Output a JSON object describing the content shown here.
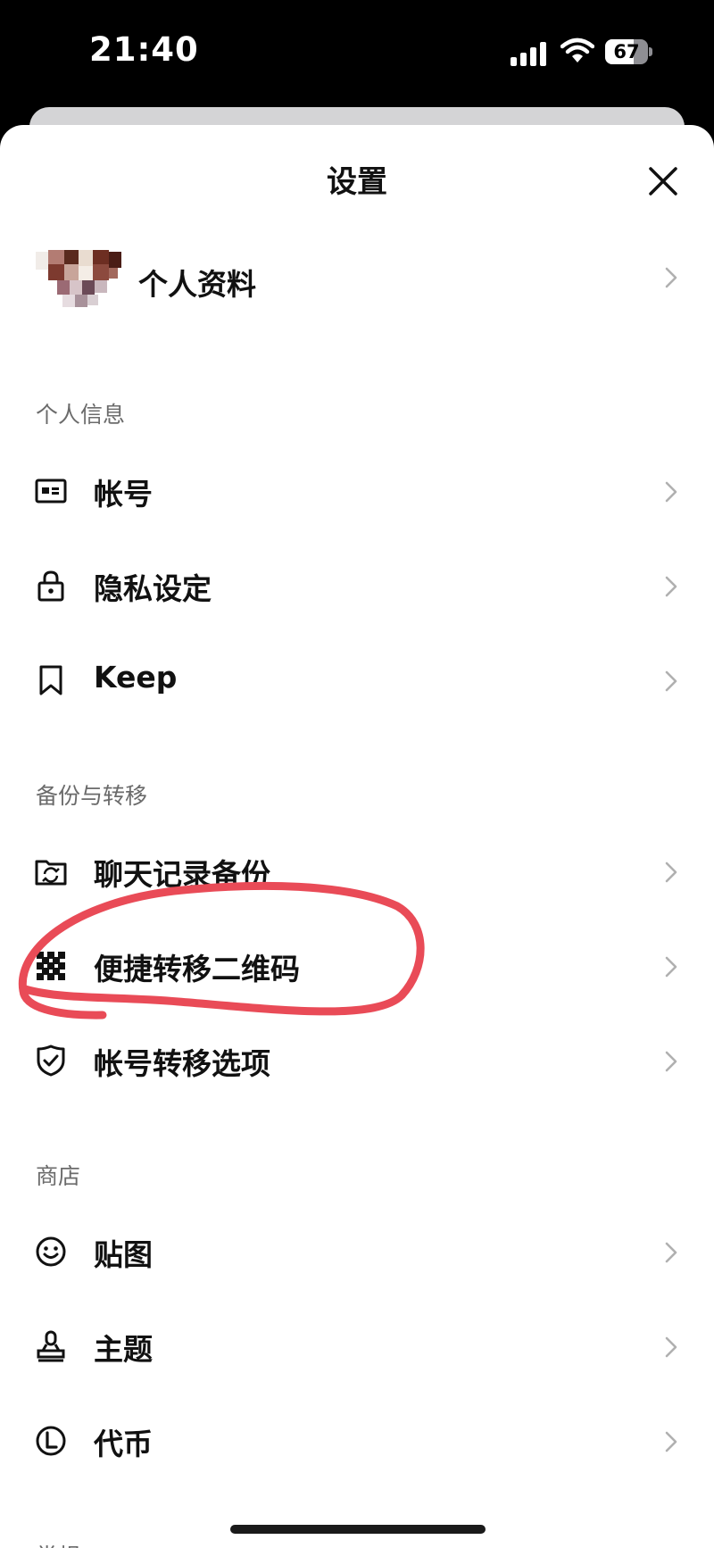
{
  "status_bar": {
    "time": "21:40",
    "battery_percent": "67",
    "battery_level": 0.67
  },
  "sheet": {
    "title": "设置"
  },
  "profile": {
    "label": "个人资料"
  },
  "sections": {
    "personal": {
      "header": "个人信息",
      "items": [
        {
          "label": "帐号",
          "icon": "id-card-icon"
        },
        {
          "label": "隐私设定",
          "icon": "lock-icon"
        },
        {
          "label": "Keep",
          "icon": "bookmark-icon"
        }
      ]
    },
    "backup": {
      "header": "备份与转移",
      "items": [
        {
          "label": "聊天记录备份",
          "icon": "folder-sync-icon"
        },
        {
          "label": "便捷转移二维码",
          "icon": "qr-code-icon"
        },
        {
          "label": "帐号转移选项",
          "icon": "shield-check-icon"
        }
      ]
    },
    "shop": {
      "header": "商店",
      "items": [
        {
          "label": "贴图",
          "icon": "smiley-icon"
        },
        {
          "label": "主题",
          "icon": "stamp-icon"
        },
        {
          "label": "代币",
          "icon": "coin-icon"
        }
      ]
    },
    "general": {
      "header": "常规"
    }
  },
  "colors": {
    "annotation": "#e94b57",
    "chevron": "#b0b0b0",
    "sheet_background": "#ffffff"
  }
}
